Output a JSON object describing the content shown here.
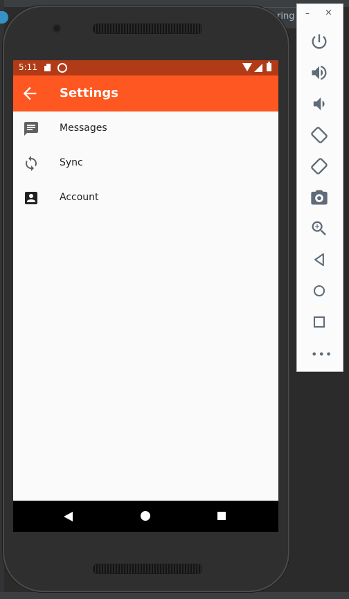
{
  "ide": {
    "tab_text": "ring"
  },
  "status_bar": {
    "time": "5:11"
  },
  "app_bar": {
    "title": "Settings",
    "back_icon": "arrow-back-icon"
  },
  "settings_items": [
    {
      "label": "Messages",
      "icon": "message-icon"
    },
    {
      "label": "Sync",
      "icon": "sync-icon"
    },
    {
      "label": "Account",
      "icon": "account-box-icon"
    }
  ],
  "nav_bar": {
    "back": "back-triangle-icon",
    "home": "home-circle-icon",
    "recent": "overview-square-icon"
  },
  "emulator_panel": {
    "minimize": "–",
    "close": "×",
    "more": "•••",
    "controls": [
      "power",
      "volume-up",
      "volume-down",
      "rotate-left",
      "rotate-right",
      "screenshot",
      "zoom",
      "back",
      "home",
      "overview"
    ]
  },
  "colors": {
    "app_bar": "#ff5722",
    "status_bar": "#b23b17",
    "background": "#fafafa",
    "nav_bar": "#000000"
  }
}
